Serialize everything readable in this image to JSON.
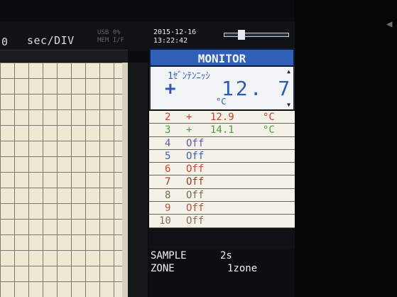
{
  "topbar": {
    "secdiv_number": "0",
    "secdiv_label": "sec/DIV",
    "usb_label": "USB",
    "usb_value": "0%",
    "mem_label": "MEM",
    "if_label": "I/F",
    "date": "2015-12-16",
    "time": "13:22:42"
  },
  "monitor": {
    "header": "MONITOR",
    "ch1": {
      "name": "1ｾﾞﾝﾃﾝﾆｯｼ",
      "sign": "+",
      "value": "12. 7",
      "unit": "°C"
    },
    "channels": [
      {
        "num": "2",
        "sign": "+",
        "value": "12.9",
        "unit": "°C",
        "color": "#d03a2a"
      },
      {
        "num": "3",
        "sign": "+",
        "value": "14.1",
        "unit": "°C",
        "color": "#4a9d3a"
      },
      {
        "num": "4",
        "text": "Off",
        "color": "#6d54a3"
      },
      {
        "num": "5",
        "text": "Off",
        "color": "#3e64b0"
      },
      {
        "num": "6",
        "text": "Off",
        "color": "#d4452c"
      },
      {
        "num": "7",
        "text": "Off",
        "color": "#9a3b2a"
      },
      {
        "num": "8",
        "text": "Off",
        "color": "#7b6a5a"
      },
      {
        "num": "9",
        "text": "Off",
        "color": "#c0503a"
      },
      {
        "num": "10",
        "text": "Off",
        "color": "#8a6e5a"
      }
    ],
    "sample_label": "SAMPLE",
    "sample_value": "2s",
    "zone_label": "ZONE",
    "zone_value": "1zone"
  },
  "icons": {
    "corner": "chevron-left-icon"
  }
}
